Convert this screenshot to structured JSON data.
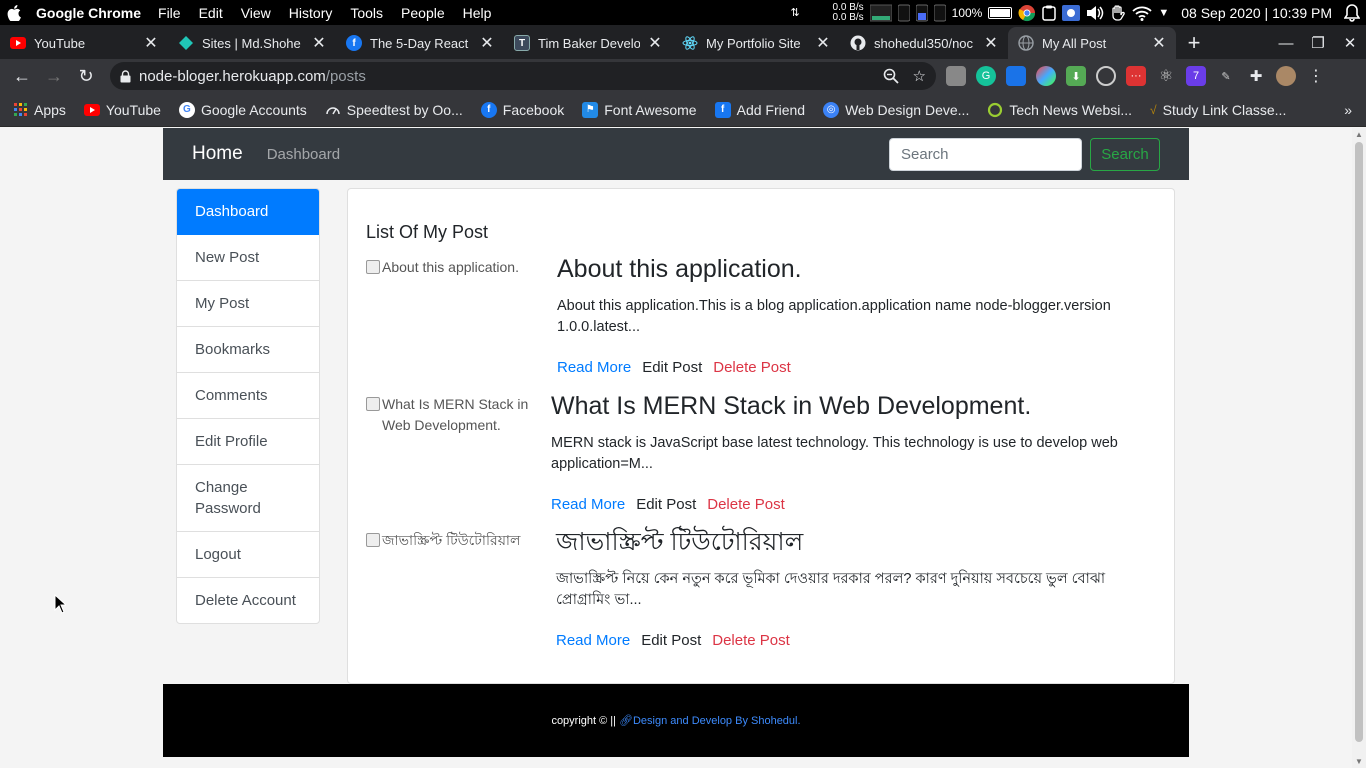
{
  "os": {
    "app_name": "Google Chrome",
    "menus": [
      "File",
      "Edit",
      "View",
      "History",
      "Tools",
      "People",
      "Help"
    ],
    "net_up": "0.0 B/s",
    "net_down": "0.0 B/s",
    "battery": "100%",
    "datetime": "08 Sep 2020 | 10:39 PM"
  },
  "tabs": [
    {
      "title": "YouTube",
      "icon": "youtube-icon",
      "color": "#ff0000",
      "active": false
    },
    {
      "title": "Sites | Md.Shohe",
      "icon": "netlify-icon",
      "color": "#20c6b7",
      "active": false
    },
    {
      "title": "The 5-Day React J",
      "icon": "facebook-icon",
      "color": "#1877f2",
      "active": false
    },
    {
      "title": "Tim Baker Develo",
      "icon": "tb-icon",
      "color": "#3d4a5c",
      "active": false
    },
    {
      "title": "My Portfolio Site",
      "icon": "react-icon",
      "color": "#4a90c8",
      "active": false
    },
    {
      "title": "shohedul350/noc",
      "icon": "github-icon",
      "color": "#555555",
      "active": false
    },
    {
      "title": "My All Post",
      "icon": "globe-icon",
      "color": "#9aa0a6",
      "active": true
    }
  ],
  "address": {
    "host": "node-bloger.herokuapp.com",
    "path": "/posts"
  },
  "bookmarks": [
    {
      "label": "Apps",
      "icon": "apps-icon",
      "color": "#4285f4"
    },
    {
      "label": "YouTube",
      "icon": "youtube-icon",
      "color": "#ff0000"
    },
    {
      "label": "Google Accounts",
      "icon": "google-icon",
      "color": "#ffffff"
    },
    {
      "label": "Speedtest by Oo...",
      "icon": "speedtest-icon",
      "color": "#35363a"
    },
    {
      "label": "Facebook",
      "icon": "facebook-icon",
      "color": "#1877f2"
    },
    {
      "label": "Font Awesome",
      "icon": "fontawesome-icon",
      "color": "#228ae6"
    },
    {
      "label": "Add Friend",
      "icon": "facebook-icon",
      "color": "#1877f2"
    },
    {
      "label": "Web Design Deve...",
      "icon": "webdesign-icon",
      "color": "#3b82f6"
    },
    {
      "label": "Tech News Websi...",
      "icon": "technews-icon",
      "color": "#9acd32"
    },
    {
      "label": "Study Link Classe...",
      "icon": "study-icon",
      "color": "#b8860b"
    }
  ],
  "navbar": {
    "brand": "Home",
    "dashboard": "Dashboard",
    "search_placeholder": "Search",
    "search_button": "Search"
  },
  "sidebar": {
    "items": [
      "Dashboard",
      "New Post",
      "My Post",
      "Bookmarks",
      "Comments",
      "Edit Profile",
      "Change Password",
      "Logout",
      "Delete Account"
    ]
  },
  "content": {
    "heading": "List Of My Post",
    "posts": [
      {
        "img_alt": "About this application.",
        "title": "About this application.",
        "excerpt": "About this application.This is a blog application.application name node-blogger.version 1.0.0.latest...",
        "read_more": "Read More",
        "edit": "Edit Post",
        "delete": "Delete Post"
      },
      {
        "img_alt": "What Is MERN Stack in Web Development.",
        "title": "What Is MERN Stack in Web Development.",
        "excerpt": "MERN stack is JavaScript base latest technology. This technology is use to develop web application=M...",
        "read_more": "Read More",
        "edit": "Edit Post",
        "delete": "Delete Post"
      },
      {
        "img_alt": "জাভাস্ক্রিপ্ট টিউটোরিয়াল",
        "title": "জাভাস্ক্রিপ্ট টিউটোরিয়াল",
        "excerpt": "জাভাস্ক্রিপ্ট নিয়ে কেন নতুন করে ভূমিকা দেওয়ার দরকার পরল? কারণ দুনিয়ায় সবচেয়ে ভুল বোঝা প্রোগ্রামিং ভা...",
        "read_more": "Read More",
        "edit": "Edit Post",
        "delete": "Delete Post"
      }
    ]
  },
  "footer": {
    "text": "copyright © ||",
    "link": "Design and Develop By Shohedul."
  }
}
